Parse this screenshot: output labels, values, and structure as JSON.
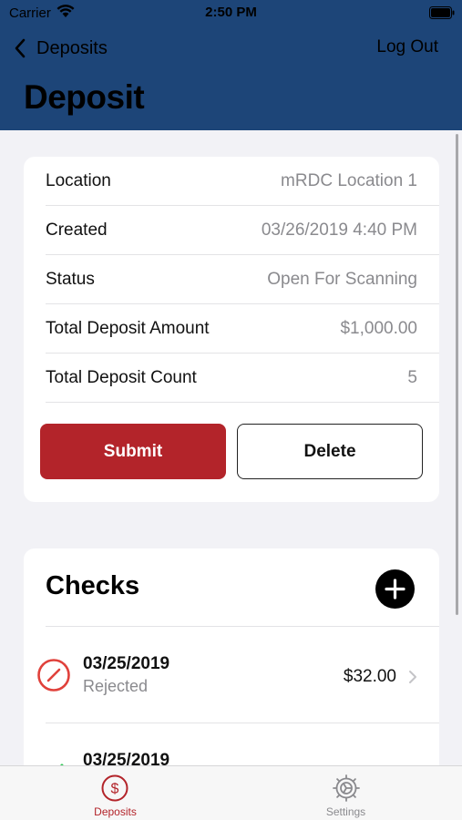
{
  "status_bar": {
    "carrier": "Carrier",
    "time": "2:50 PM"
  },
  "nav": {
    "back_label": "Deposits",
    "logout_label": "Log Out",
    "title": "Deposit"
  },
  "details": [
    {
      "label": "Location",
      "value": "mRDC Location 1"
    },
    {
      "label": "Created",
      "value": "03/26/2019 4:40 PM"
    },
    {
      "label": "Status",
      "value": "Open For Scanning"
    },
    {
      "label": "Total Deposit Amount",
      "value": "$1,000.00"
    },
    {
      "label": "Total Deposit Count",
      "value": "5"
    }
  ],
  "actions": {
    "submit_label": "Submit",
    "delete_label": "Delete"
  },
  "checks": {
    "title": "Checks",
    "items": [
      {
        "date": "03/25/2019",
        "status": "Rejected",
        "amount": "$32.00",
        "icon": "rejected-icon"
      },
      {
        "date": "03/25/2019",
        "status": "",
        "amount": "",
        "icon": "accepted-checkmark-icon"
      }
    ]
  },
  "tabs": [
    {
      "label": "Deposits",
      "icon": "dollar-circle-icon",
      "active": true
    },
    {
      "label": "Settings",
      "icon": "gear-icon",
      "active": false
    }
  ],
  "colors": {
    "header": "#1d4578",
    "accent_red": "#b3242a",
    "rejected_red": "#e0413b",
    "accepted_green": "#34c759",
    "secondary_text": "#8a8a8e"
  }
}
